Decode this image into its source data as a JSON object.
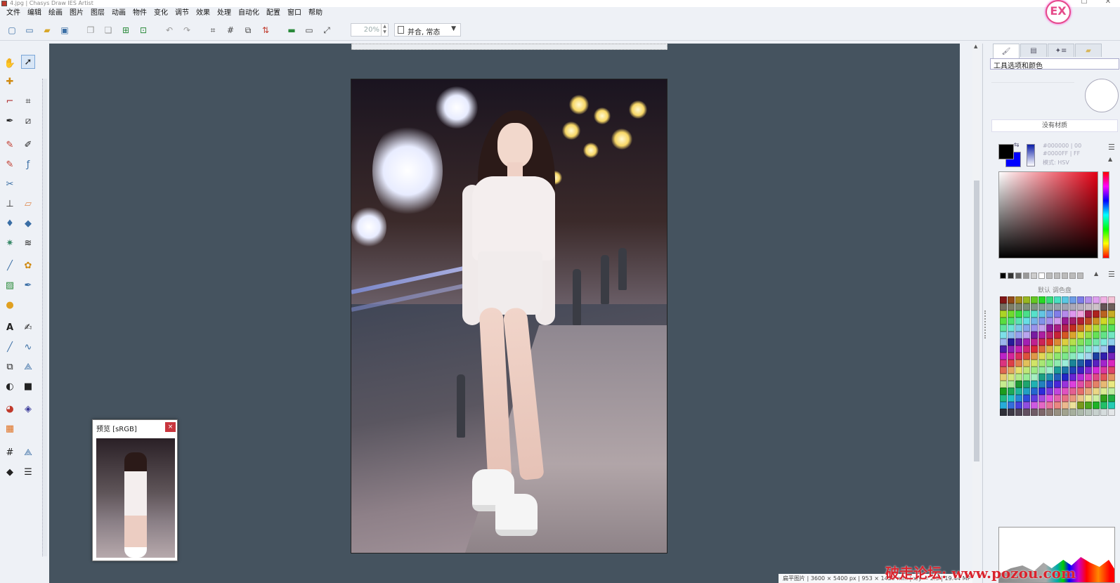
{
  "window": {
    "title": "4.jpg | Chasys Draw IES Artist",
    "min": "—",
    "max": "☐",
    "close": "✕"
  },
  "logo": {
    "text": "EX"
  },
  "menu": [
    "文件",
    "编辑",
    "绘画",
    "图片",
    "图层",
    "动画",
    "物件",
    "变化",
    "调节",
    "效果",
    "处理",
    "自动化",
    "配置",
    "窗口",
    "帮助"
  ],
  "toolbar": {
    "zoom": "20%",
    "mode": "并合, 常态",
    "icons": [
      "new-file-icon",
      "open-icon",
      "open-folder-icon",
      "save-icon",
      "copy-icon",
      "paste-icon",
      "add-layer-icon",
      "add-frame-icon",
      "undo-icon",
      "redo-icon",
      "crop-icon",
      "grid-icon",
      "resize-icon",
      "flip-icon",
      "fit-icon",
      "window-icon",
      "fullscreen-icon"
    ]
  },
  "preview": {
    "title": "预览 [sRGB]",
    "close": "×"
  },
  "panel": {
    "tabs": [
      "tool-options",
      "layers",
      "effects",
      "files"
    ],
    "header": "工具选项和颜色",
    "material": "没有材质",
    "color1": "#000000 | 00",
    "color2": "#0000FF | FF",
    "color_mode": "模式: HSV",
    "palette_name": "默认 调色盘"
  },
  "colors": {
    "foreground": "#000000",
    "background": "#0000FF",
    "workspace": "#45535F",
    "accent": "#C8353D"
  },
  "status": "扁平图片 | 3600 × 5400 px | 953 × 1429 mm | x/y = 2:3 | 19.44 MP",
  "watermark": "破走论坛: www.pozou.com"
}
